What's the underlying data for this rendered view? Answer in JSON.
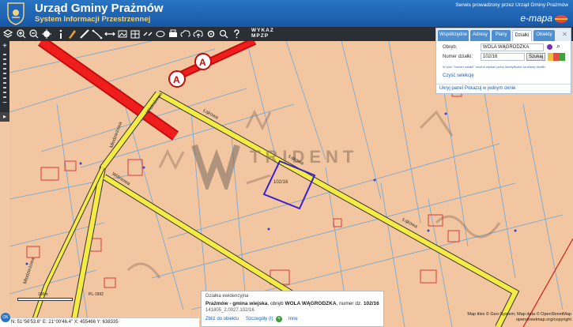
{
  "header": {
    "title": "Urząd Gminy Prażmów",
    "subtitle": "System Informacji Przestrzennej",
    "service_text": "Serwis prowadzony przez Urząd Gminy Prażmów",
    "emapa_label": "e-mapa"
  },
  "toolbar": {
    "icons": [
      "layers-icon",
      "zoom-in-icon",
      "zoom-out-icon",
      "zoom-extent-icon",
      "info-icon",
      "pencil-icon",
      "ruler-icon",
      "measure-icon",
      "pan-icon",
      "image-icon",
      "link-icon",
      "print-icon",
      "cloud-download-icon",
      "cloud-upload-icon",
      "settings-icon",
      "search-icon",
      "help-icon"
    ],
    "wykaz_label": "WYKAZ",
    "mpzp_label": "MPZP"
  },
  "panel": {
    "tabs": [
      "Współrzędne",
      "Adresy",
      "Plany",
      "Działki",
      "Obiekty"
    ],
    "active_tab": "Działki",
    "obreb_label": "Obręb:",
    "obreb_value": "WOLA WĄGRODZKA",
    "numer_label": "Numer działki:",
    "numer_value": "102/16",
    "search_button": "Szukaj",
    "hint": "W polu \"Numer działki\" można wpisać pełny identyfikator szukanej działki.",
    "clear_link": "Czyść selekcję",
    "hide_panel": "Ukryj panel",
    "show_one_window": "Pokazuj w jednym oknie"
  },
  "map": {
    "plot_label": "102/16",
    "road_labels": [
      "Łąkowa",
      "Łąkowa",
      "Łąkowa",
      "Wiatrakowa",
      "Młodzieżowa",
      "Wiśniowa",
      "Młodzieżowa"
    ],
    "route_marker": "A",
    "watermark": "TRIDENT"
  },
  "popup": {
    "title": "Działka ewidencyjna",
    "gmina": "Prażmów - gmina wiejska",
    "obreb_prefix": ", obręb ",
    "obreb": "WOLA WĄGRODZKA",
    "nr_prefix": ", numer dz. ",
    "nr": "102/16",
    "identifier": "141805_2.0027.102/16",
    "link_zoom": "Zbliż do obiektu",
    "link_details": "Szczegóły (I)",
    "link_other": "Inne"
  },
  "status": {
    "scale_label": "100m",
    "projection": "PL-1992",
    "coords": "N: 51°56'53.6\"  E: 21°00'46.4\"  X: 455466   Y: 638335",
    "ok_label": "OK",
    "attribution_line1": "Map tiles © Geo-System; Map data © OpenStreetMap",
    "attribution_line2": "openstreetmap.org/copyright"
  }
}
